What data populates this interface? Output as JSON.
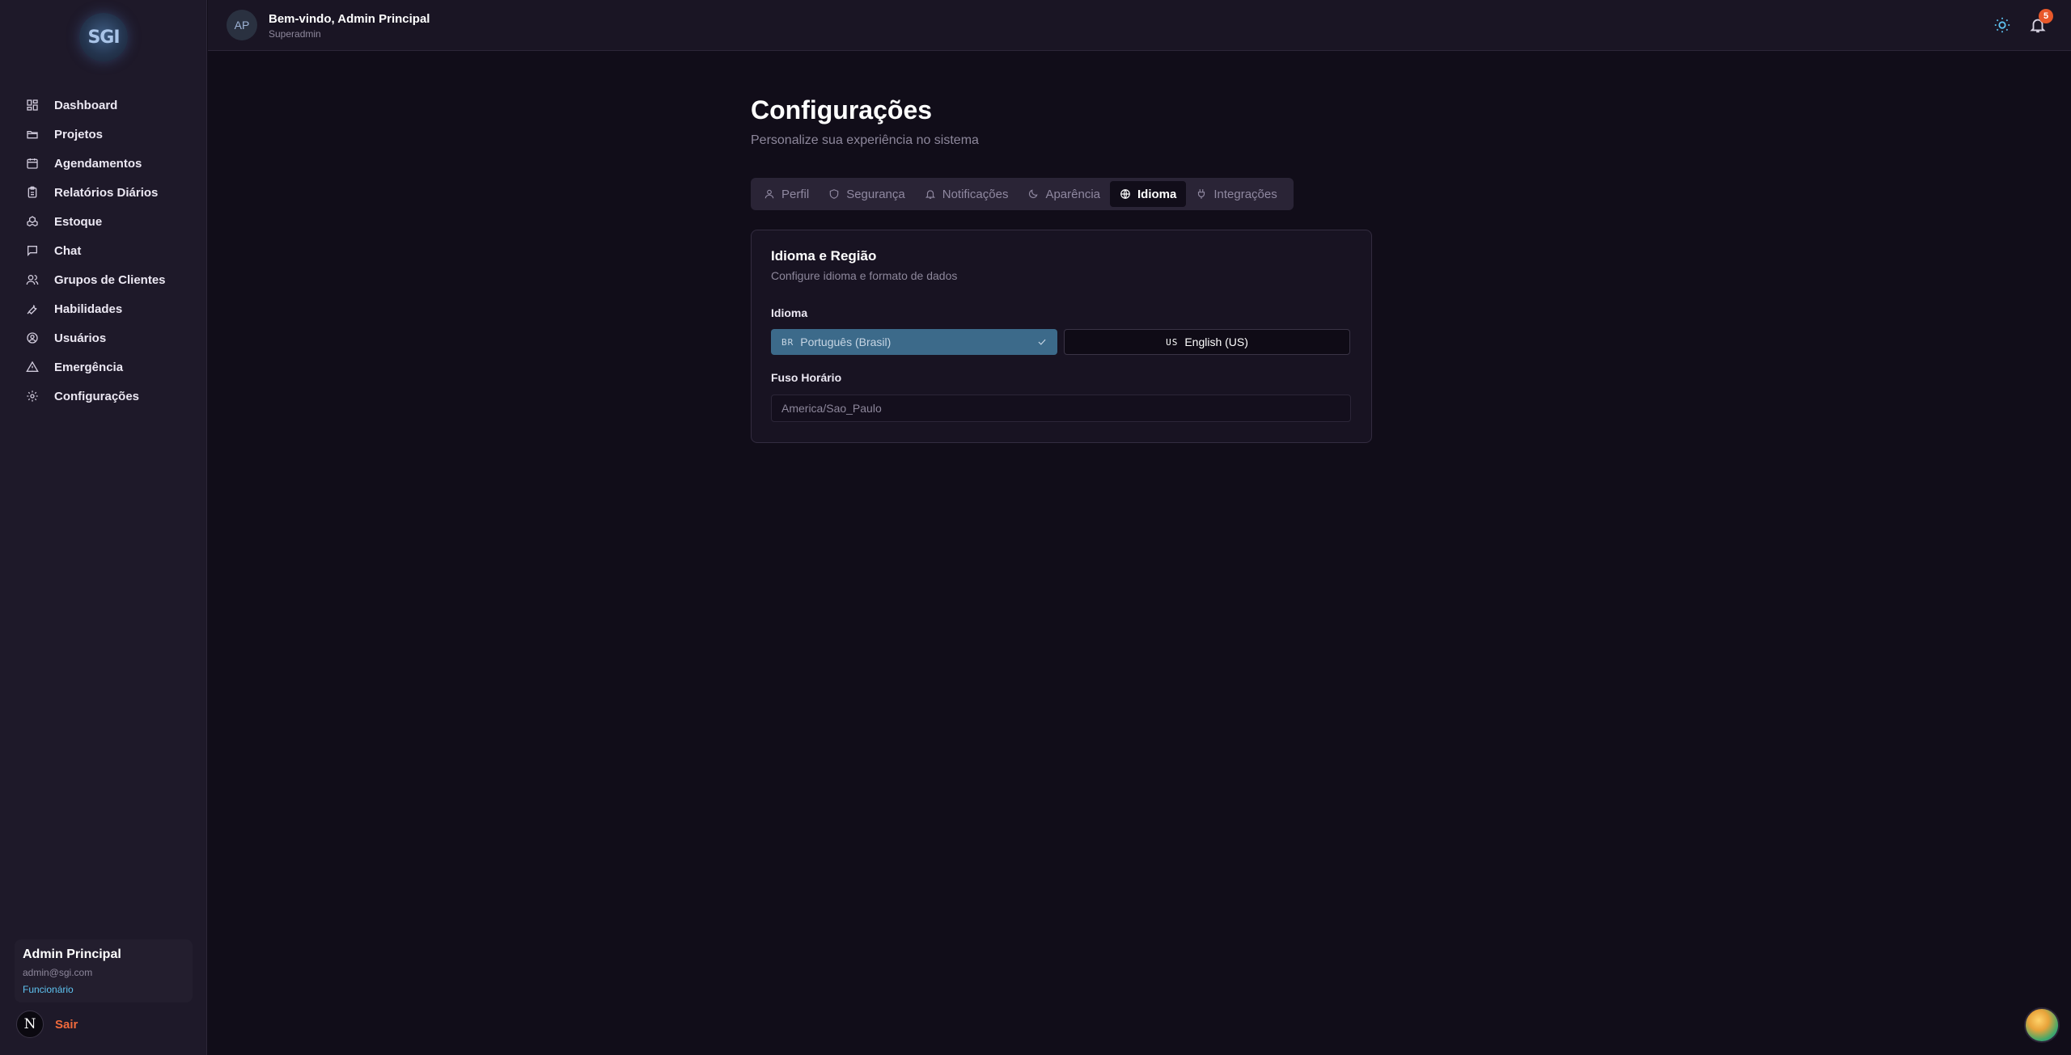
{
  "app": {
    "logo_text": "SGI"
  },
  "sidebar": {
    "items": [
      {
        "label": "Dashboard",
        "icon": "grid-icon"
      },
      {
        "label": "Projetos",
        "icon": "folder-icon"
      },
      {
        "label": "Agendamentos",
        "icon": "calendar-icon"
      },
      {
        "label": "Relatórios Diários",
        "icon": "clipboard-icon"
      },
      {
        "label": "Estoque",
        "icon": "boxes-icon"
      },
      {
        "label": "Chat",
        "icon": "message-icon"
      },
      {
        "label": "Grupos de Clientes",
        "icon": "users-icon"
      },
      {
        "label": "Habilidades",
        "icon": "wrench-icon"
      },
      {
        "label": "Usuários",
        "icon": "user-circle-icon"
      },
      {
        "label": "Emergência",
        "icon": "alert-triangle-icon"
      },
      {
        "label": "Configurações",
        "icon": "gear-icon"
      }
    ],
    "user": {
      "name": "Admin Principal",
      "email": "admin@sgi.com",
      "role": "Funcionário"
    },
    "avatar_letter": "N",
    "logout_label": "Sair"
  },
  "header": {
    "avatar_initials": "AP",
    "welcome": "Bem-vindo, Admin Principal",
    "role": "Superadmin",
    "notification_count": "5"
  },
  "page": {
    "title": "Configurações",
    "subtitle": "Personalize sua experiência no sistema"
  },
  "tabs": [
    {
      "label": "Perfil",
      "icon": "user-icon",
      "active": false
    },
    {
      "label": "Segurança",
      "icon": "shield-icon",
      "active": false
    },
    {
      "label": "Notificações",
      "icon": "bell-icon",
      "active": false
    },
    {
      "label": "Aparência",
      "icon": "moon-icon",
      "active": false
    },
    {
      "label": "Idioma",
      "icon": "globe-icon",
      "active": true
    },
    {
      "label": "Integrações",
      "icon": "plug-icon",
      "active": false
    }
  ],
  "card": {
    "title": "Idioma e Região",
    "description": "Configure idioma e formato de dados",
    "language_label": "Idioma",
    "languages": [
      {
        "code": "BR",
        "label": "Português (Brasil)",
        "selected": true
      },
      {
        "code": "US",
        "label": "English (US)",
        "selected": false
      }
    ],
    "timezone_label": "Fuso Horário",
    "timezone_value": "America/Sao_Paulo"
  },
  "colors": {
    "accent": "#5ec3f0",
    "selected_language_bg": "#3c6a8a",
    "badge": "#e8582a",
    "logout": "#f06a3c"
  }
}
